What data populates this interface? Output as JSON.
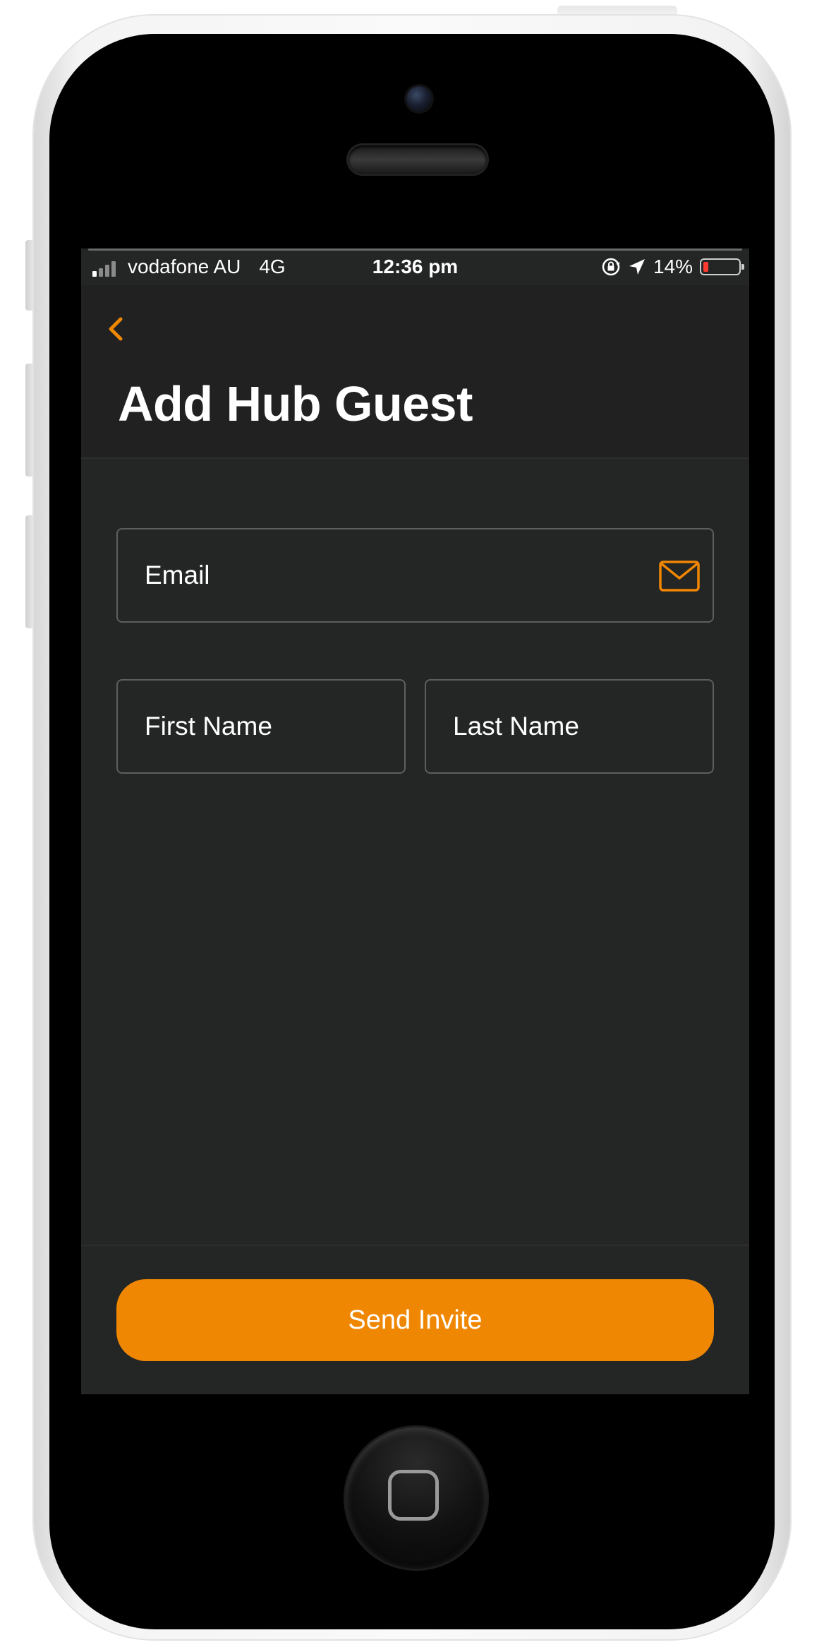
{
  "status_bar": {
    "carrier": "vodafone AU",
    "network": "4G",
    "time": "12:36 pm",
    "battery_percent": "14%",
    "battery_level": 0.14,
    "signal_bars_active": 1,
    "signal_bars_total": 4
  },
  "header": {
    "back_icon": "chevron-left-icon",
    "title": "Add Hub Guest"
  },
  "form": {
    "email": {
      "value": "",
      "placeholder": "Email",
      "icon": "envelope-icon"
    },
    "first_name": {
      "value": "",
      "placeholder": "First Name"
    },
    "last_name": {
      "value": "",
      "placeholder": "Last Name"
    }
  },
  "footer": {
    "send_label": "Send Invite"
  },
  "colors": {
    "accent": "#f08703",
    "background": "#242525",
    "header_background": "#212121",
    "field_border": "#5d5e60",
    "text": "#ffffff",
    "battery_low": "#ff3b30"
  }
}
